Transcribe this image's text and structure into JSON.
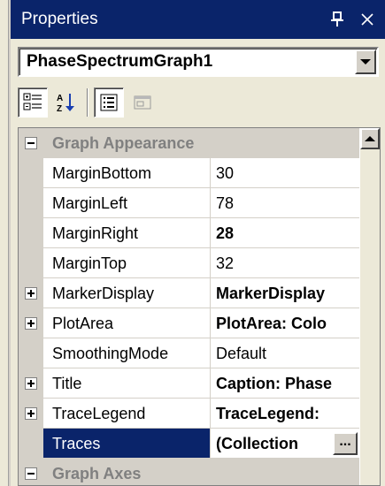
{
  "window": {
    "title": "Properties",
    "pin_glyph": "ɐ",
    "close_glyph": "✕"
  },
  "object_selector": {
    "value": "PhaseSpectrumGraph1"
  },
  "toolbar": {
    "buttons": [
      {
        "icon": "categorized-icon",
        "pressed": true
      },
      {
        "icon": "alphabetical-icon",
        "pressed": false
      },
      {
        "icon": "properties-icon",
        "pressed": true
      },
      {
        "icon": "events-icon",
        "pressed": false
      }
    ]
  },
  "grid": {
    "categories": [
      {
        "label": "Graph Appearance",
        "expanded": true
      },
      {
        "label": "Graph Axes",
        "expanded": true
      }
    ],
    "rows": [
      {
        "name": "MarginBottom",
        "value": "30"
      },
      {
        "name": "MarginLeft",
        "value": "78"
      },
      {
        "name": "MarginRight",
        "value": "28"
      },
      {
        "name": "MarginTop",
        "value": "32"
      },
      {
        "name": "MarkerDisplay",
        "value": "MarkerDisplay"
      },
      {
        "name": "PlotArea",
        "value": "PlotArea: Colo"
      },
      {
        "name": "SmoothingMode",
        "value": "Default"
      },
      {
        "name": "Title",
        "value": "Caption: Phase"
      },
      {
        "name": "TraceLegend",
        "value": "TraceLegend:"
      },
      {
        "name": "Traces",
        "value": "(Collection",
        "button": "..."
      }
    ]
  },
  "colors": {
    "title_bar": "#0a246a",
    "selection": "#0a246a",
    "panel": "#ece9d8"
  }
}
